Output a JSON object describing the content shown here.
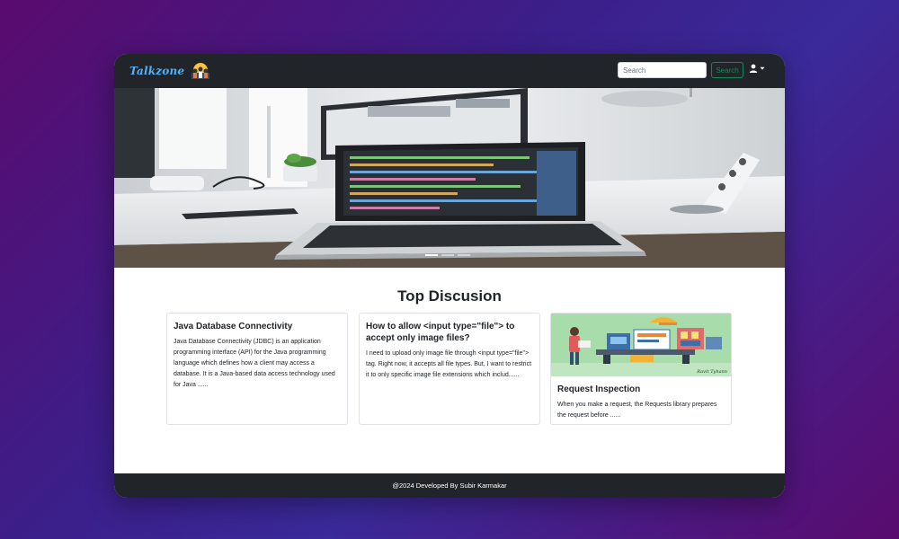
{
  "navbar": {
    "brand": "Talkzone",
    "search_placeholder": "Search",
    "search_button": "Search"
  },
  "main": {
    "section_title": "Top Discusion",
    "cards": [
      {
        "title": "Java Database Connectivity",
        "text": "Java Database Connectivity (JDBC) is an application programming interface (API) for the Java programming language which defines how a client may access a database. It is a Java-based data access technology used for Java ......"
      },
      {
        "title": "How to allow <input type=\"file\"> to accept only image files?",
        "text": "I need to upload only image file through <input type=\"file\"> tag. Right now, it accepts all file types. But, I want to restrict it to only specific image file extensions which includ......"
      },
      {
        "title": "Request Inspection",
        "text": "When you make a request, the Requests library prepares the request before ......",
        "image_caption": "Ravit Tyhann"
      }
    ]
  },
  "footer": {
    "text": "@2024 Developed By Subir Karmakar"
  },
  "colors": {
    "navbar_bg": "#212529",
    "brand_text": "#4fb3ff",
    "search_button": "#198754"
  }
}
